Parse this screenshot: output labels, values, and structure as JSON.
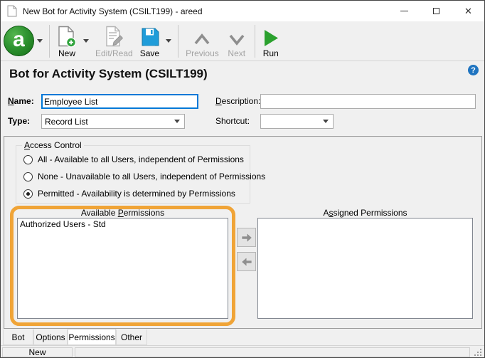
{
  "window": {
    "title": "New Bot for Activity System (CSILT199) - areed"
  },
  "toolbar": {
    "logo_letter": "a",
    "new_label": "New",
    "edit_read_label": "Edit/Read",
    "save_label": "Save",
    "previous_label": "Previous",
    "next_label": "Next",
    "run_label": "Run"
  },
  "page": {
    "title": "Bot for Activity System (CSILT199)"
  },
  "form": {
    "name": {
      "label": {
        "text": "Name:",
        "u": 0
      },
      "value": "Employee List"
    },
    "description": {
      "label": {
        "text": "Description:",
        "u": 0
      },
      "value": ""
    },
    "type": {
      "label": {
        "text": "Type:",
        "u": -1
      },
      "value": "Record List"
    },
    "shortcut": {
      "label": {
        "text": "Shortcut:",
        "u": -1
      },
      "value": ""
    }
  },
  "access_control": {
    "group_label": {
      "text": "Access Control",
      "u": 0
    },
    "options": [
      {
        "label": "All - Available to all Users, independent of Permissions",
        "selected": false
      },
      {
        "label": "None - Unavailable to all Users, independent of Permissions",
        "selected": false
      },
      {
        "label": "Permitted - Availability is determined by Permissions",
        "selected": true
      }
    ]
  },
  "permissions": {
    "available": {
      "label": {
        "text": "Available Permissions",
        "u": 10
      },
      "items": [
        "Authorized Users - Std"
      ]
    },
    "assigned": {
      "label": {
        "text": "Assigned Permissions",
        "u": 1
      },
      "items": []
    }
  },
  "tabs": [
    {
      "label": "Bot",
      "active": false
    },
    {
      "label": "Options",
      "active": false
    },
    {
      "label": "Permissions",
      "active": true
    },
    {
      "label": "Other",
      "active": false
    }
  ],
  "statusbar": {
    "left": "New"
  },
  "icons": {
    "titlebar": "document-icon",
    "toolbar": [
      "app-logo-a",
      "new-document-icon",
      "edit-read-icon",
      "save-floppy-icon",
      "chevron-up-icon",
      "chevron-down-icon",
      "run-play-icon"
    ],
    "header": "help-icon",
    "lists": [
      "move-right-icon",
      "move-left-icon"
    ]
  },
  "colors": {
    "focus_border": "#0078d7",
    "highlight_orange": "#f0a437",
    "logo_green": "#2f9431",
    "save_blue": "#1f9cd9",
    "run_green": "#2ba12e",
    "help_blue": "#1f74c0"
  }
}
